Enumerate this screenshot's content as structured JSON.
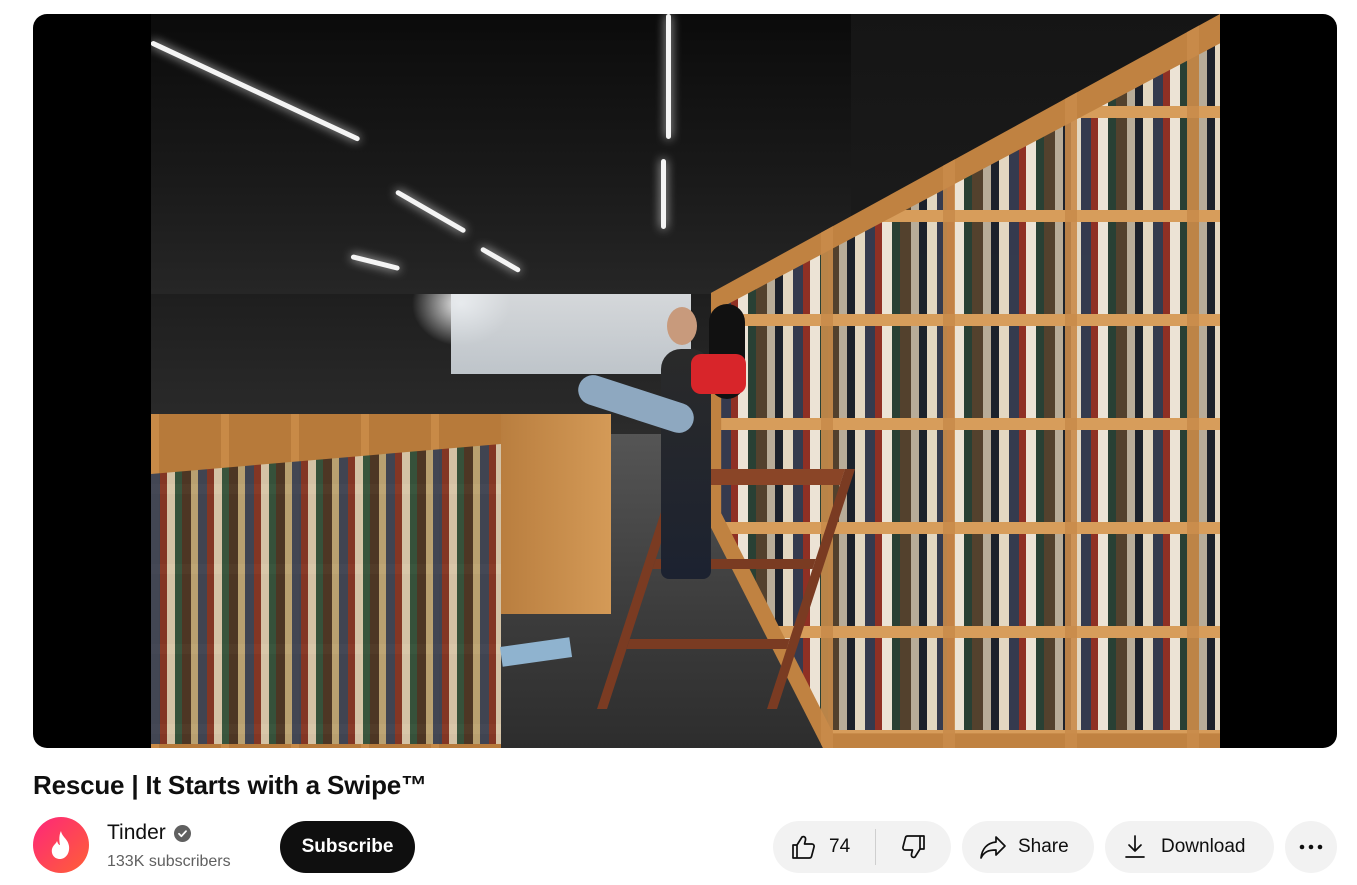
{
  "video": {
    "title": "Rescue | It Starts with a Swipe™"
  },
  "channel": {
    "name": "Tinder",
    "subscribers": "133K subscribers",
    "verified": true,
    "avatar_icon": "flame-icon",
    "avatar_colors": [
      "#fd267a",
      "#ff6036"
    ]
  },
  "actions": {
    "subscribe_label": "Subscribe",
    "like_count": "74",
    "share_label": "Share",
    "download_label": "Download"
  },
  "icons": {
    "like": "thumbs-up-icon",
    "dislike": "thumbs-down-icon",
    "share": "share-arrow-icon",
    "download": "download-icon",
    "more": "more-horizontal-icon",
    "verified": "checkmark-badge-icon"
  }
}
